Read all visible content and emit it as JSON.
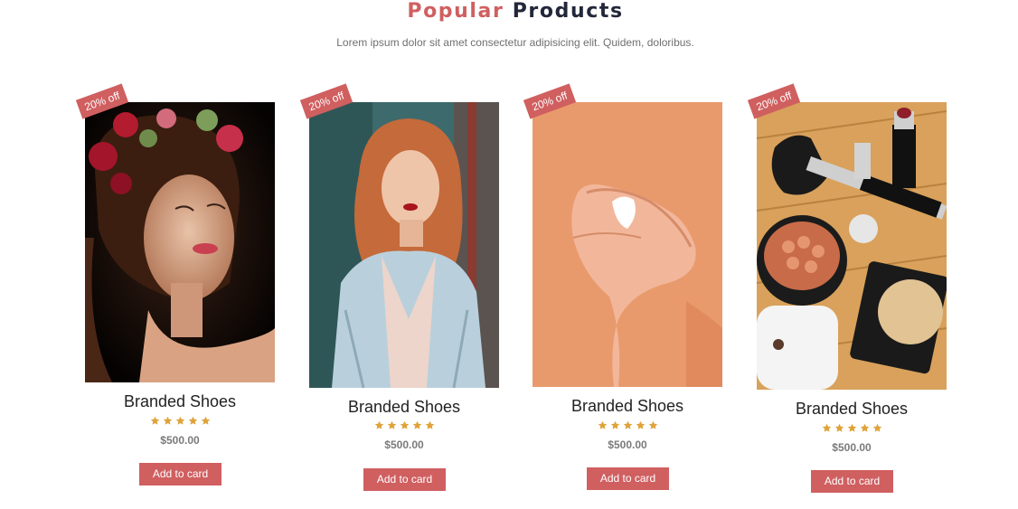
{
  "section": {
    "title_part1": "Popular",
    "title_part2": "Products",
    "subtitle": "Lorem ipsum dolor sit amet consectetur adipisicing elit. Quidem, doloribus."
  },
  "colors": {
    "accent": "#d05f60",
    "dark": "#23273a",
    "star": "#e0a33a"
  },
  "products": [
    {
      "badge": "20% off",
      "name": "Branded Shoes",
      "rating": 5,
      "price": "$500.00",
      "button": "Add to card"
    },
    {
      "badge": "20% off",
      "name": "Branded Shoes",
      "rating": 5,
      "price": "$500.00",
      "button": "Add to card"
    },
    {
      "badge": "20% off",
      "name": "Branded Shoes",
      "rating": 5,
      "price": "$500.00",
      "button": "Add to card"
    },
    {
      "badge": "20% off",
      "name": "Branded Shoes",
      "rating": 5,
      "price": "$500.00",
      "button": "Add to card"
    }
  ]
}
